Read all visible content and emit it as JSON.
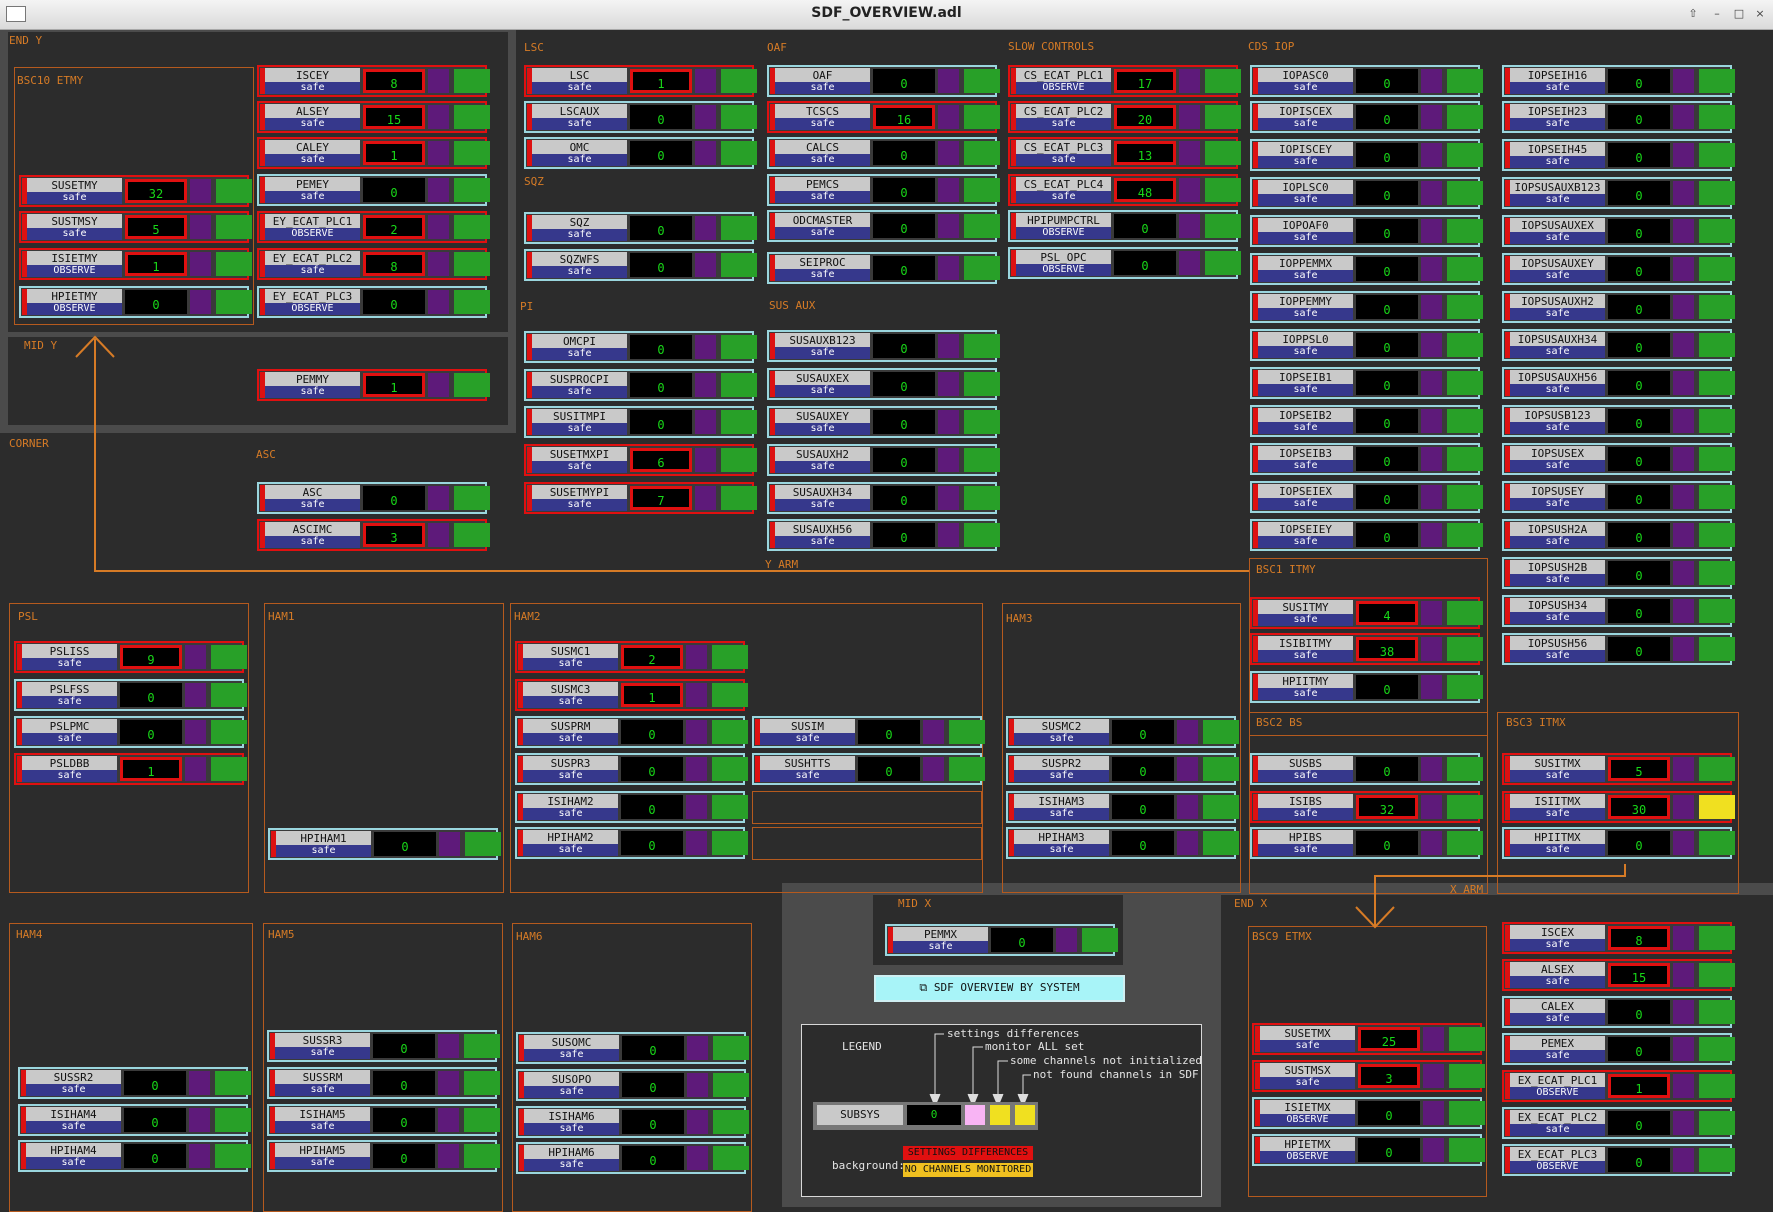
{
  "window": {
    "title": "SDF_OVERVIEW.adl"
  },
  "labels": {
    "end_y": "END Y",
    "bsc10": "BSC10 ETMY",
    "mid_y": "MID Y",
    "corner": "CORNER",
    "asc": "ASC",
    "lsc": "LSC",
    "sqz": "SQZ",
    "pi": "PI",
    "oaf": "OAF",
    "sus_aux": "SUS AUX",
    "slow": "SLOW CONTROLS",
    "cds": "CDS IOP",
    "y_arm": "Y ARM",
    "x_arm": "X ARM",
    "bsc1": "BSC1 ITMY",
    "bsc2": "BSC2 BS",
    "bsc3": "BSC3 ITMX",
    "psl": "PSL",
    "ham1": "HAM1",
    "ham2": "HAM2",
    "ham3": "HAM3",
    "ham4": "HAM4",
    "ham5": "HAM5",
    "ham6": "HAM6",
    "mid_x": "MID X",
    "end_x": "END X",
    "bsc9": "BSC9 ETMX"
  },
  "nav": {
    "sdf_by_system": "SDF OVERVIEW BY SYSTEM"
  },
  "legend": {
    "title": "LEGEND",
    "subsys": "SUBSYS",
    "value": "0",
    "settings": "settings differences",
    "monitor": "monitor ALL set",
    "notinit": "some channels not initialized",
    "notfound": "not found channels in SDF",
    "background": "background:",
    "bg_settings": "SETTINGS DIFFERENCES",
    "bg_nochan": "NO CHANNELS MONITORED"
  },
  "colors": {
    "frame": "#b55a1e",
    "label": "#d67b26",
    "diff": "#e01010",
    "ok": "#28a028",
    "value": "#18d818",
    "monitor": "#5e1a7a",
    "notinit": "#f0e020",
    "legend_pink": "#f8b4f4"
  },
  "widgets": [
    {
      "n": "SUSETMY",
      "s": "safe",
      "v": "32",
      "d": 1
    },
    {
      "n": "SUSTMSY",
      "s": "safe",
      "v": "5",
      "d": 1
    },
    {
      "n": "ISIETMY",
      "s": "OBSERVE",
      "v": "1",
      "d": 1
    },
    {
      "n": "HPIETMY",
      "s": "OBSERVE",
      "v": "0",
      "d": 0
    },
    {
      "n": "ISCEY",
      "s": "safe",
      "v": "8",
      "d": 1
    },
    {
      "n": "ALSEY",
      "s": "safe",
      "v": "15",
      "d": 1
    },
    {
      "n": "CALEY",
      "s": "safe",
      "v": "1",
      "d": 1
    },
    {
      "n": "PEMEY",
      "s": "safe",
      "v": "0",
      "d": 0
    },
    {
      "n": "EY_ECAT_PLC1",
      "s": "OBSERVE",
      "v": "2",
      "d": 1
    },
    {
      "n": "EY_ECAT_PLC2",
      "s": "safe",
      "v": "8",
      "d": 1
    },
    {
      "n": "EY_ECAT_PLC3",
      "s": "OBSERVE",
      "v": "0",
      "d": 0
    },
    {
      "n": "PEMMY",
      "s": "safe",
      "v": "1",
      "d": 1
    },
    {
      "n": "ASC",
      "s": "safe",
      "v": "0",
      "d": 0
    },
    {
      "n": "ASCIMC",
      "s": "safe",
      "v": "3",
      "d": 1
    },
    {
      "n": "LSC",
      "s": "safe",
      "v": "1",
      "d": 1
    },
    {
      "n": "LSCAUX",
      "s": "safe",
      "v": "0",
      "d": 0
    },
    {
      "n": "OMC",
      "s": "safe",
      "v": "0",
      "d": 0
    },
    {
      "n": "SQZ",
      "s": "safe",
      "v": "0",
      "d": 0
    },
    {
      "n": "SQZWFS",
      "s": "safe",
      "v": "0",
      "d": 0
    },
    {
      "n": "OMCPI",
      "s": "safe",
      "v": "0",
      "d": 0
    },
    {
      "n": "SUSPROCPI",
      "s": "safe",
      "v": "0",
      "d": 0
    },
    {
      "n": "SUSITMPI",
      "s": "safe",
      "v": "0",
      "d": 0
    },
    {
      "n": "SUSETMXPI",
      "s": "safe",
      "v": "6",
      "d": 1
    },
    {
      "n": "SUSETMYPI",
      "s": "safe",
      "v": "7",
      "d": 1
    },
    {
      "n": "OAF",
      "s": "safe",
      "v": "0",
      "d": 0
    },
    {
      "n": "TCSCS",
      "s": "safe",
      "v": "16",
      "d": 1
    },
    {
      "n": "CALCS",
      "s": "safe",
      "v": "0",
      "d": 0
    },
    {
      "n": "PEMCS",
      "s": "safe",
      "v": "0",
      "d": 0
    },
    {
      "n": "ODCMASTER",
      "s": "safe",
      "v": "0",
      "d": 0
    },
    {
      "n": "SEIPROC",
      "s": "safe",
      "v": "0",
      "d": 0
    },
    {
      "n": "SUSAUXB123",
      "s": "safe",
      "v": "0",
      "d": 0
    },
    {
      "n": "SUSAUXEX",
      "s": "safe",
      "v": "0",
      "d": 0
    },
    {
      "n": "SUSAUXEY",
      "s": "safe",
      "v": "0",
      "d": 0
    },
    {
      "n": "SUSAUXH2",
      "s": "safe",
      "v": "0",
      "d": 0
    },
    {
      "n": "SUSAUXH34",
      "s": "safe",
      "v": "0",
      "d": 0
    },
    {
      "n": "SUSAUXH56",
      "s": "safe",
      "v": "0",
      "d": 0
    },
    {
      "n": "CS_ECAT_PLC1",
      "s": "OBSERVE",
      "v": "17",
      "d": 1
    },
    {
      "n": "CS_ECAT_PLC2",
      "s": "safe",
      "v": "20",
      "d": 1
    },
    {
      "n": "CS_ECAT_PLC3",
      "s": "safe",
      "v": "13",
      "d": 1
    },
    {
      "n": "CS_ECAT_PLC4",
      "s": "safe",
      "v": "48",
      "d": 1
    },
    {
      "n": "HPIPUMPCTRL",
      "s": "OBSERVE",
      "v": "0",
      "d": 0
    },
    {
      "n": "PSL_OPC",
      "s": "OBSERVE",
      "v": "0",
      "d": 0
    },
    {
      "n": "IOPASC0",
      "s": "safe",
      "v": "0",
      "d": 0
    },
    {
      "n": "IOPISCEX",
      "s": "safe",
      "v": "0",
      "d": 0
    },
    {
      "n": "IOPISCEY",
      "s": "safe",
      "v": "0",
      "d": 0
    },
    {
      "n": "IOPLSC0",
      "s": "safe",
      "v": "0",
      "d": 0
    },
    {
      "n": "IOPOAF0",
      "s": "safe",
      "v": "0",
      "d": 0
    },
    {
      "n": "IOPPEMMX",
      "s": "safe",
      "v": "0",
      "d": 0
    },
    {
      "n": "IOPPEMMY",
      "s": "safe",
      "v": "0",
      "d": 0
    },
    {
      "n": "IOPPSL0",
      "s": "safe",
      "v": "0",
      "d": 0
    },
    {
      "n": "IOPSEIB1",
      "s": "safe",
      "v": "0",
      "d": 0
    },
    {
      "n": "IOPSEIB2",
      "s": "safe",
      "v": "0",
      "d": 0
    },
    {
      "n": "IOPSEIB3",
      "s": "safe",
      "v": "0",
      "d": 0
    },
    {
      "n": "IOPSEIEX",
      "s": "safe",
      "v": "0",
      "d": 0
    },
    {
      "n": "IOPSEIEY",
      "s": "safe",
      "v": "0",
      "d": 0
    },
    {
      "n": "IOPSEIH16",
      "s": "safe",
      "v": "0",
      "d": 0
    },
    {
      "n": "IOPSEIH23",
      "s": "safe",
      "v": "0",
      "d": 0
    },
    {
      "n": "IOPSEIH45",
      "s": "safe",
      "v": "0",
      "d": 0
    },
    {
      "n": "IOPSUSAUXB123",
      "s": "safe",
      "v": "0",
      "d": 0
    },
    {
      "n": "IOPSUSAUXEX",
      "s": "safe",
      "v": "0",
      "d": 0
    },
    {
      "n": "IOPSUSAUXEY",
      "s": "safe",
      "v": "0",
      "d": 0
    },
    {
      "n": "IOPSUSAUXH2",
      "s": "safe",
      "v": "0",
      "d": 0
    },
    {
      "n": "IOPSUSAUXH34",
      "s": "safe",
      "v": "0",
      "d": 0
    },
    {
      "n": "IOPSUSAUXH56",
      "s": "safe",
      "v": "0",
      "d": 0
    },
    {
      "n": "IOPSUSB123",
      "s": "safe",
      "v": "0",
      "d": 0
    },
    {
      "n": "IOPSUSEX",
      "s": "safe",
      "v": "0",
      "d": 0
    },
    {
      "n": "IOPSUSEY",
      "s": "safe",
      "v": "0",
      "d": 0
    },
    {
      "n": "IOPSUSH2A",
      "s": "safe",
      "v": "0",
      "d": 0
    },
    {
      "n": "IOPSUSH2B",
      "s": "safe",
      "v": "0",
      "d": 0
    },
    {
      "n": "IOPSUSH34",
      "s": "safe",
      "v": "0",
      "d": 0
    },
    {
      "n": "IOPSUSH56",
      "s": "safe",
      "v": "0",
      "d": 0
    },
    {
      "n": "SUSITMY",
      "s": "safe",
      "v": "4",
      "d": 1
    },
    {
      "n": "ISIBITMY",
      "s": "safe",
      "v": "38",
      "d": 1
    },
    {
      "n": "HPIITMY",
      "s": "safe",
      "v": "0",
      "d": 0
    },
    {
      "n": "PSLISS",
      "s": "safe",
      "v": "9",
      "d": 1
    },
    {
      "n": "PSLFSS",
      "s": "safe",
      "v": "0",
      "d": 0
    },
    {
      "n": "PSLPMC",
      "s": "safe",
      "v": "0",
      "d": 0
    },
    {
      "n": "PSLDBB",
      "s": "safe",
      "v": "1",
      "d": 1
    },
    {
      "n": "HPIHAM1",
      "s": "safe",
      "v": "0",
      "d": 0
    },
    {
      "n": "SUSMC1",
      "s": "safe",
      "v": "2",
      "d": 1
    },
    {
      "n": "SUSMC3",
      "s": "safe",
      "v": "1",
      "d": 1
    },
    {
      "n": "SUSPRM",
      "s": "safe",
      "v": "0",
      "d": 0
    },
    {
      "n": "SUSPR3",
      "s": "safe",
      "v": "0",
      "d": 0
    },
    {
      "n": "ISIHAM2",
      "s": "safe",
      "v": "0",
      "d": 0
    },
    {
      "n": "HPIHAM2",
      "s": "safe",
      "v": "0",
      "d": 0
    },
    {
      "n": "SUSIM",
      "s": "safe",
      "v": "0",
      "d": 0
    },
    {
      "n": "SUSHTTS",
      "s": "safe",
      "v": "0",
      "d": 0
    },
    {
      "n": "SUSMC2",
      "s": "safe",
      "v": "0",
      "d": 0
    },
    {
      "n": "SUSPR2",
      "s": "safe",
      "v": "0",
      "d": 0
    },
    {
      "n": "ISIHAM3",
      "s": "safe",
      "v": "0",
      "d": 0
    },
    {
      "n": "HPIHAM3",
      "s": "safe",
      "v": "0",
      "d": 0
    },
    {
      "n": "SUSBS",
      "s": "safe",
      "v": "0",
      "d": 0
    },
    {
      "n": "ISIBS",
      "s": "safe",
      "v": "32",
      "d": 1
    },
    {
      "n": "HPIBS",
      "s": "safe",
      "v": "0",
      "d": 0
    },
    {
      "n": "SUSITMX",
      "s": "safe",
      "v": "5",
      "d": 1
    },
    {
      "n": "ISIITMX",
      "s": "safe",
      "v": "30",
      "d": 1,
      "y": 1
    },
    {
      "n": "HPIITMX",
      "s": "safe",
      "v": "0",
      "d": 0
    },
    {
      "n": "SUSSR2",
      "s": "safe",
      "v": "0",
      "d": 0
    },
    {
      "n": "ISIHAM4",
      "s": "safe",
      "v": "0",
      "d": 0
    },
    {
      "n": "HPIHAM4",
      "s": "safe",
      "v": "0",
      "d": 0
    },
    {
      "n": "SUSSR3",
      "s": "safe",
      "v": "0",
      "d": 0
    },
    {
      "n": "SUSSRM",
      "s": "safe",
      "v": "0",
      "d": 0
    },
    {
      "n": "ISIHAM5",
      "s": "safe",
      "v": "0",
      "d": 0
    },
    {
      "n": "HPIHAM5",
      "s": "safe",
      "v": "0",
      "d": 0
    },
    {
      "n": "SUSOMC",
      "s": "safe",
      "v": "0",
      "d": 0
    },
    {
      "n": "SUSOPO",
      "s": "safe",
      "v": "0",
      "d": 0
    },
    {
      "n": "ISIHAM6",
      "s": "safe",
      "v": "0",
      "d": 0
    },
    {
      "n": "HPIHAM6",
      "s": "safe",
      "v": "0",
      "d": 0
    },
    {
      "n": "PEMMX",
      "s": "safe",
      "v": "0",
      "d": 0
    },
    {
      "n": "SUSETMX",
      "s": "safe",
      "v": "25",
      "d": 1
    },
    {
      "n": "SUSTMSX",
      "s": "safe",
      "v": "3",
      "d": 1
    },
    {
      "n": "ISIETMX",
      "s": "OBSERVE",
      "v": "0",
      "d": 0
    },
    {
      "n": "HPIETMX",
      "s": "OBSERVE",
      "v": "0",
      "d": 0
    },
    {
      "n": "ISCEX",
      "s": "safe",
      "v": "8",
      "d": 1
    },
    {
      "n": "ALSEX",
      "s": "safe",
      "v": "15",
      "d": 1
    },
    {
      "n": "CALEX",
      "s": "safe",
      "v": "0",
      "d": 0
    },
    {
      "n": "PEMEX",
      "s": "safe",
      "v": "0",
      "d": 0
    },
    {
      "n": "EX_ECAT_PLC1",
      "s": "OBSERVE",
      "v": "1",
      "d": 1
    },
    {
      "n": "EX_ECAT_PLC2",
      "s": "safe",
      "v": "0",
      "d": 0
    },
    {
      "n": "EX_ECAT_PLC3",
      "s": "OBSERVE",
      "v": "0",
      "d": 0
    }
  ]
}
